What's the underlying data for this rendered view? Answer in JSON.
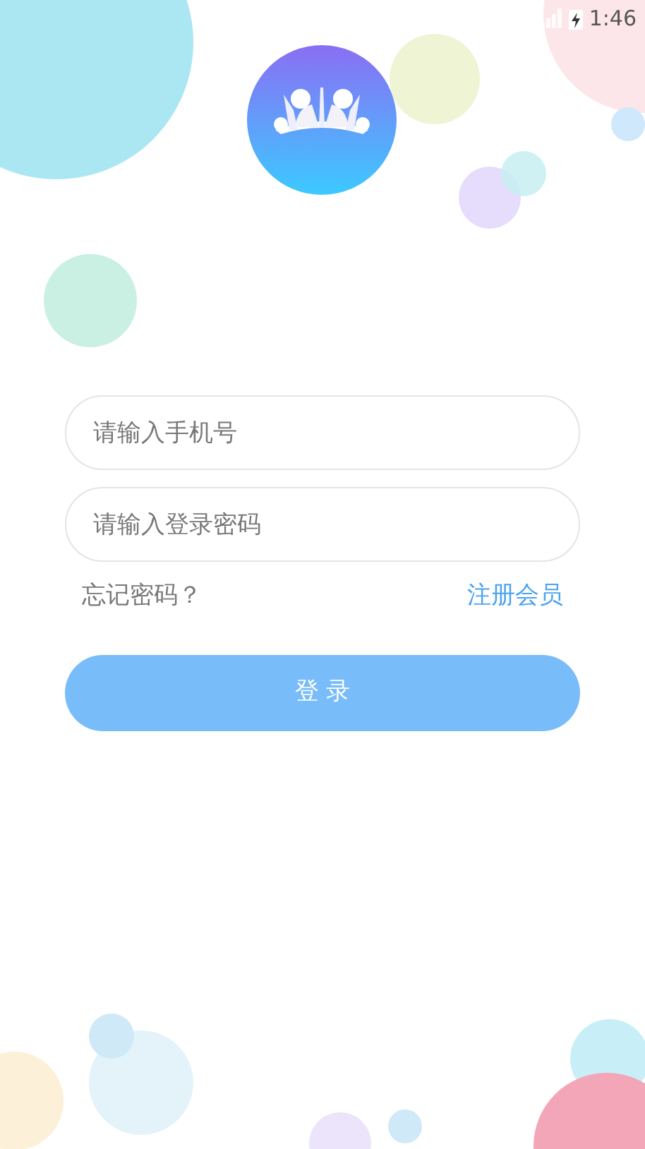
{
  "status_bar": {
    "time": "1:46"
  },
  "form": {
    "phone": {
      "placeholder": "请输入手机号"
    },
    "password": {
      "placeholder": "请输入登录密码"
    },
    "forgot_link": "忘记密码？",
    "register_link": "注册会员",
    "login_button": "登 录"
  }
}
